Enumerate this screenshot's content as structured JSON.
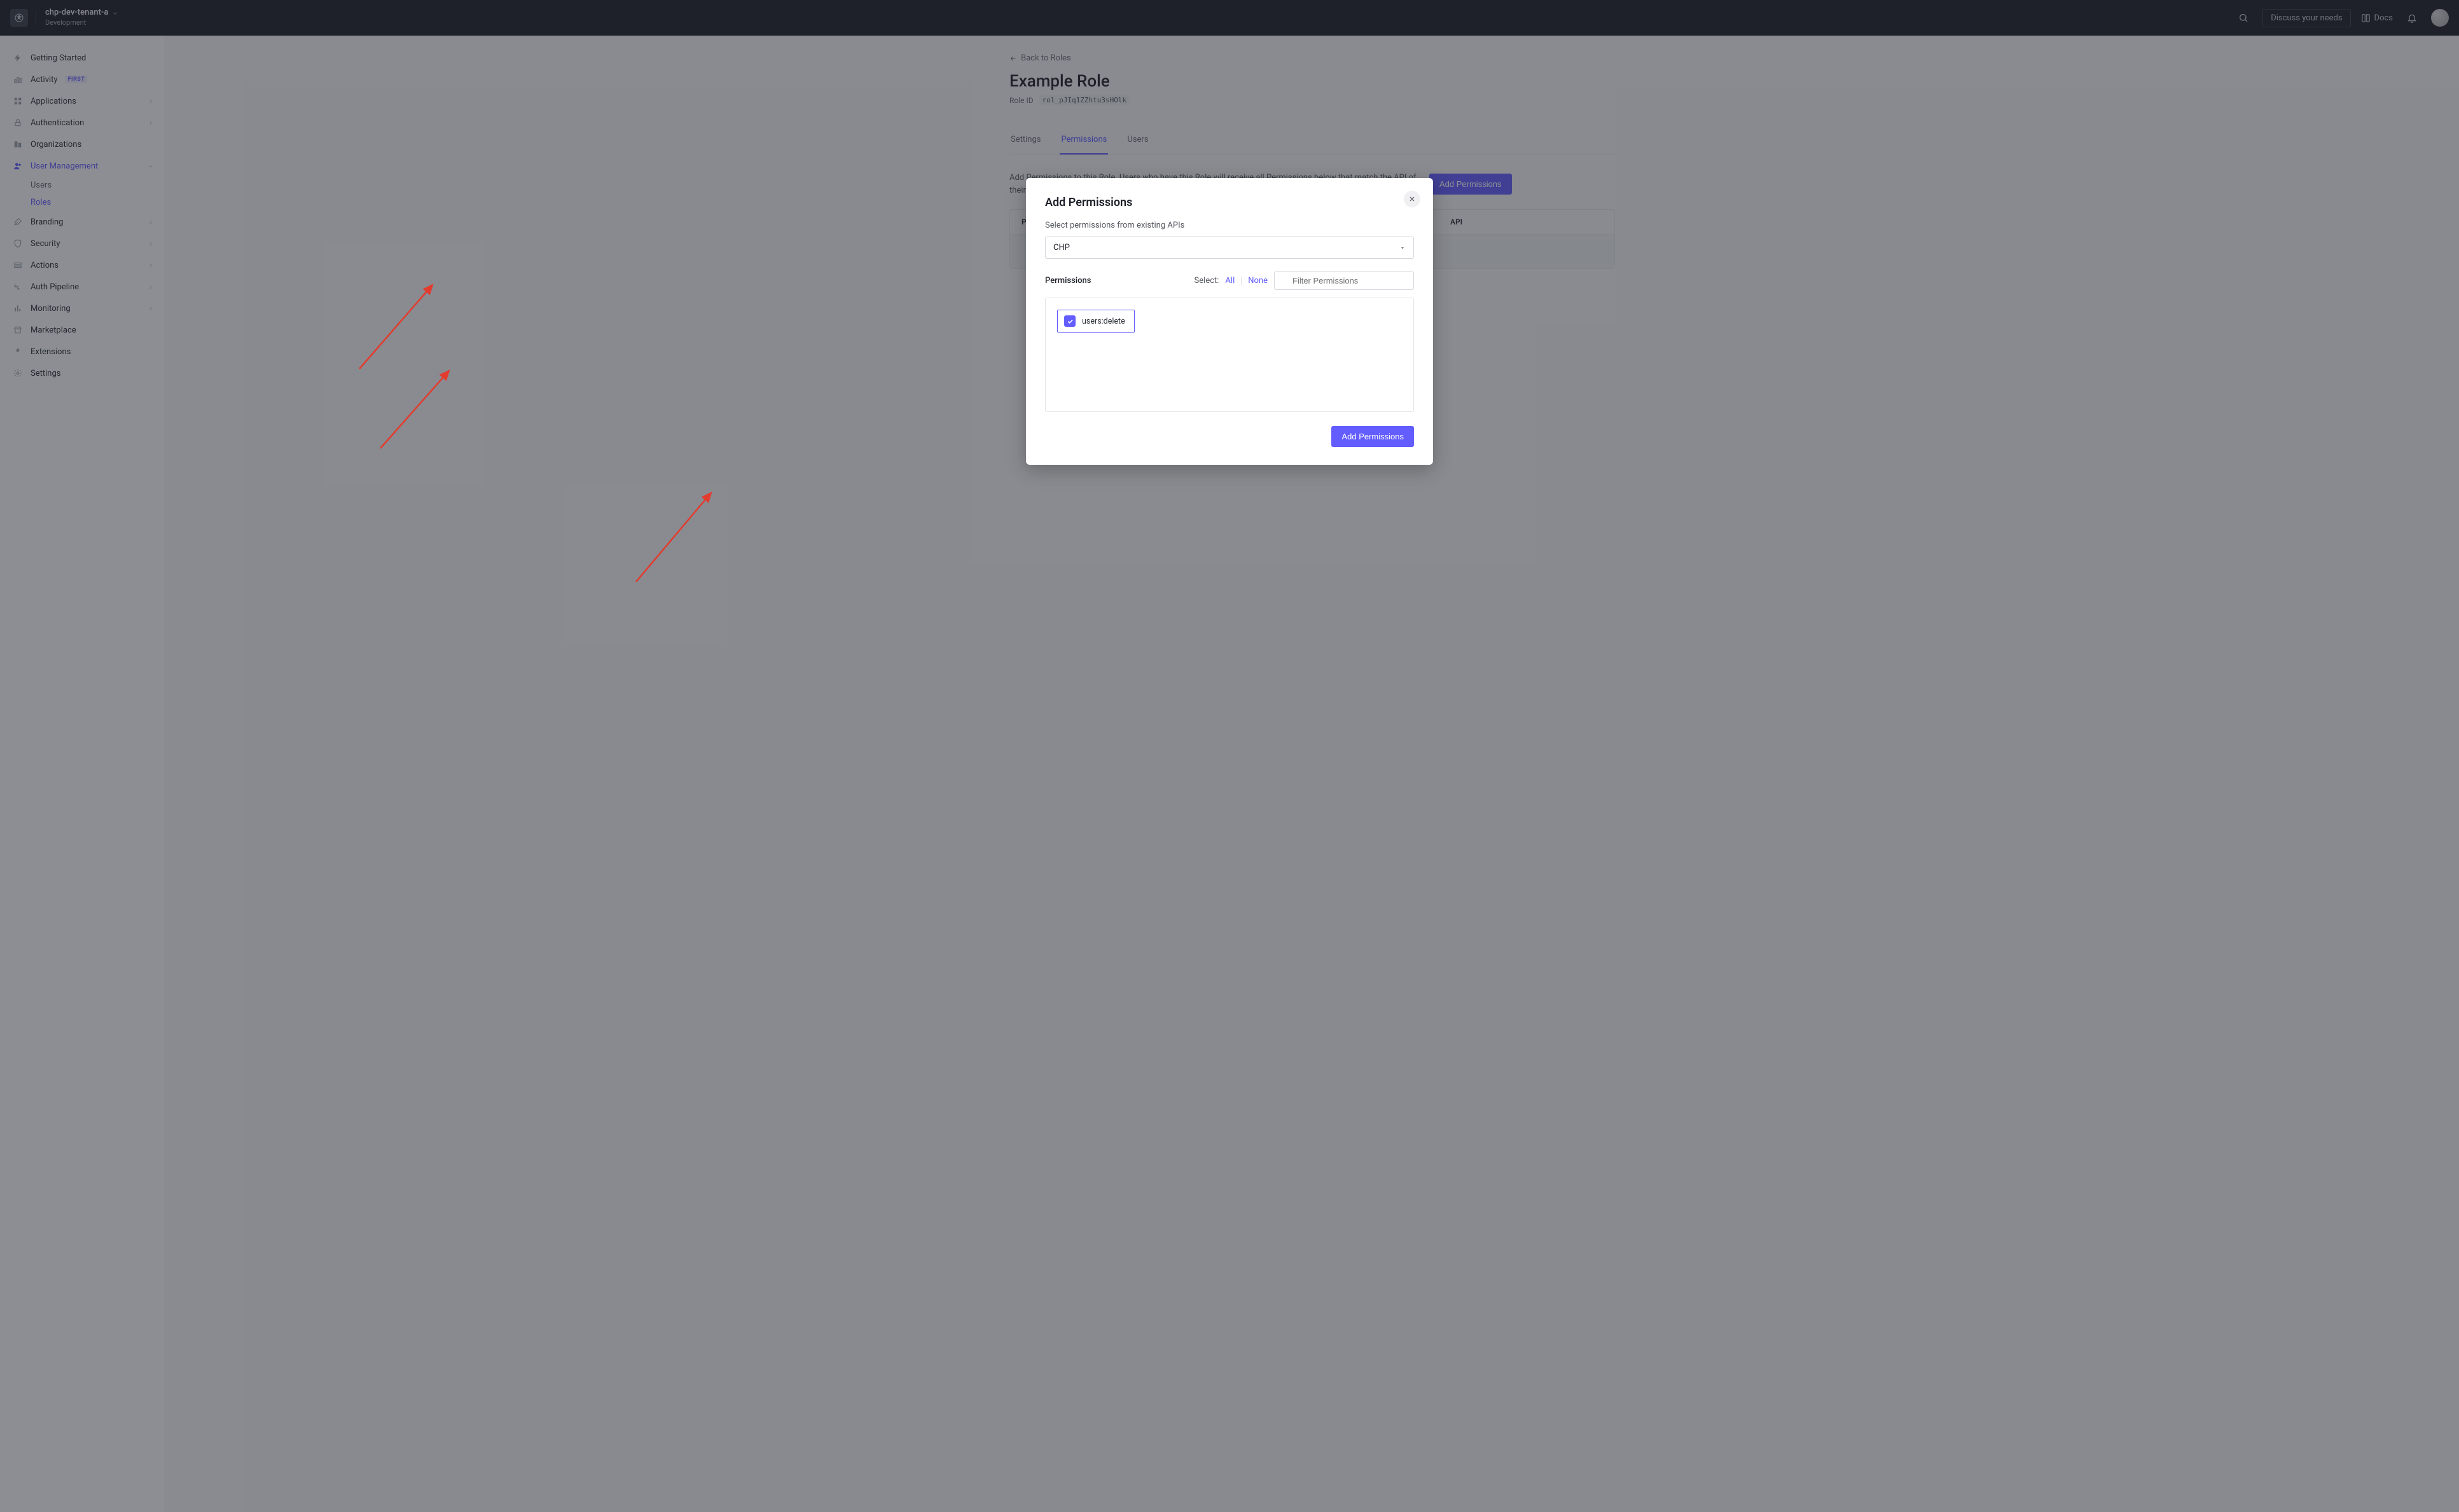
{
  "header": {
    "tenant_name": "chp-dev-tenant-a",
    "tenant_env": "Development",
    "discuss_label": "Discuss your needs",
    "docs_label": "Docs"
  },
  "sidebar": {
    "items": [
      {
        "label": "Getting Started"
      },
      {
        "label": "Activity",
        "badge": "FIRST"
      },
      {
        "label": "Applications"
      },
      {
        "label": "Authentication"
      },
      {
        "label": "Organizations"
      },
      {
        "label": "User Management",
        "active": true
      },
      {
        "label": "Branding"
      },
      {
        "label": "Security"
      },
      {
        "label": "Actions"
      },
      {
        "label": "Auth Pipeline"
      },
      {
        "label": "Monitoring"
      },
      {
        "label": "Marketplace"
      },
      {
        "label": "Extensions"
      },
      {
        "label": "Settings"
      }
    ],
    "user_mgmt_sub": [
      {
        "label": "Users"
      },
      {
        "label": "Roles",
        "active": true
      }
    ]
  },
  "main": {
    "back_label": "Back to Roles",
    "title": "Example Role",
    "role_id_label": "Role ID",
    "role_id_value": "rol_pJIq1ZZhtu3sHOlk",
    "tabs": [
      {
        "label": "Settings"
      },
      {
        "label": "Permissions",
        "active": true
      },
      {
        "label": "Users"
      }
    ],
    "intro_text": "Add Permissions to this Role. Users who have this Role will receive all Permissions below that match the API of their login request.",
    "add_permissions_btn": "Add Permissions",
    "table": {
      "col_permission": "Permission",
      "col_api": "API"
    }
  },
  "modal": {
    "title": "Add Permissions",
    "select_label": "Select permissions from existing APIs",
    "api_value": "CHP",
    "permissions_label": "Permissions",
    "select_prefix": "Select:",
    "all_label": "All",
    "none_label": "None",
    "filter_placeholder": "Filter Permissions",
    "permission_item": "users:delete",
    "submit_label": "Add Permissions"
  }
}
